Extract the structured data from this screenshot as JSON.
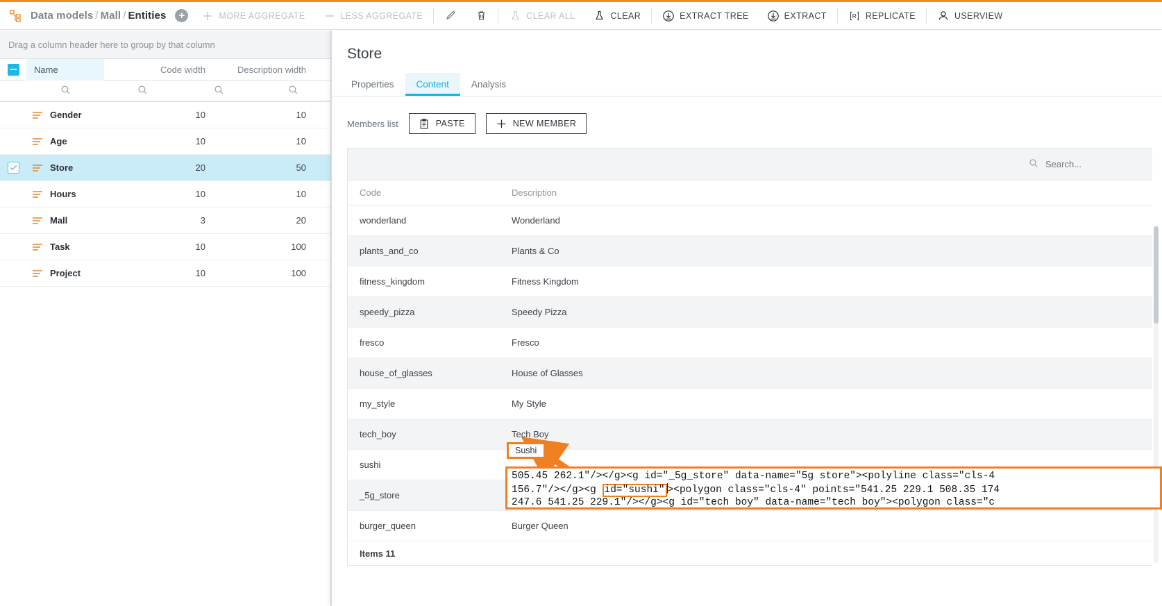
{
  "toolbar": {
    "breadcrumb": {
      "root": "Data models",
      "mid": "Mall",
      "leaf": "Entities",
      "sep": "/"
    },
    "add_label": "+",
    "buttons": [
      {
        "name": "more-aggregate",
        "label": "MORE AGGREGATE",
        "icon": "plus-icon",
        "disabled": true
      },
      {
        "name": "less-aggregate",
        "label": "LESS AGGREGATE",
        "icon": "minus-icon",
        "disabled": true
      },
      {
        "name": "edit",
        "label": "",
        "icon": "pencil-icon",
        "disabled": false
      },
      {
        "name": "delete",
        "label": "",
        "icon": "trash-icon",
        "disabled": false
      },
      {
        "name": "clear-all",
        "label": "CLEAR ALL",
        "icon": "flask-icon",
        "disabled": true
      },
      {
        "name": "clear",
        "label": "CLEAR",
        "icon": "flask-icon",
        "disabled": false
      },
      {
        "name": "extract-tree",
        "label": "EXTRACT TREE",
        "icon": "download-circle-icon",
        "disabled": false
      },
      {
        "name": "extract",
        "label": "EXTRACT",
        "icon": "download-circle-icon",
        "disabled": false
      },
      {
        "name": "replicate",
        "label": "REPLICATE",
        "icon": "bracket-r-icon",
        "disabled": false
      },
      {
        "name": "userview",
        "label": "USERVIEW",
        "icon": "user-icon",
        "disabled": false
      }
    ]
  },
  "left_grid": {
    "group_panel_text": "Drag a column header here to group by that column",
    "columns": [
      "Name",
      "Code width",
      "Description width"
    ],
    "rows": [
      {
        "name": "Gender",
        "code_width": "10",
        "description_width": "10",
        "selected": false
      },
      {
        "name": "Age",
        "code_width": "10",
        "description_width": "10",
        "selected": false
      },
      {
        "name": "Store",
        "code_width": "20",
        "description_width": "50",
        "selected": true
      },
      {
        "name": "Hours",
        "code_width": "10",
        "description_width": "10",
        "selected": false
      },
      {
        "name": "Mall",
        "code_width": "3",
        "description_width": "20",
        "selected": false
      },
      {
        "name": "Task",
        "code_width": "10",
        "description_width": "100",
        "selected": false
      },
      {
        "name": "Project",
        "code_width": "10",
        "description_width": "100",
        "selected": false
      }
    ]
  },
  "detail": {
    "title": "Store",
    "tabs": [
      {
        "label": "Properties",
        "active": false
      },
      {
        "label": "Content",
        "active": true
      },
      {
        "label": "Analysis",
        "active": false
      }
    ],
    "members_label": "Members list",
    "paste_button": "PASTE",
    "new_member_button": "NEW MEMBER",
    "search_placeholder": "Search...",
    "table": {
      "columns": [
        "Code",
        "Description"
      ],
      "rows": [
        {
          "code": "wonderland",
          "description": "Wonderland"
        },
        {
          "code": "plants_and_co",
          "description": "Plants & Co"
        },
        {
          "code": "fitness_kingdom",
          "description": "Fitness Kingdom"
        },
        {
          "code": "speedy_pizza",
          "description": "Speedy Pizza"
        },
        {
          "code": "fresco",
          "description": "Fresco"
        },
        {
          "code": "house_of_glasses",
          "description": "House of Glasses"
        },
        {
          "code": "my_style",
          "description": "My Style"
        },
        {
          "code": "tech_boy",
          "description": "Tech Boy"
        },
        {
          "code": "sushi",
          "description": "Sushi"
        },
        {
          "code": "_5g_store",
          "description": ""
        },
        {
          "code": "burger_queen",
          "description": "Burger Queen"
        }
      ],
      "footer": "Items 11"
    }
  },
  "annotation": {
    "highlight_value": "Sushi",
    "code_lines": [
      "505.45 262.1\"/></g><g id=\"_5g_store\" data-name=\"5g store\"><polyline class=\"cls-4",
      "156.7\"/></g><g id=\"sushi\"><polygon class=\"cls-4\" points=\"541.25 229.1 508.35 174",
      "247.6 541.25 229.1\"/></g><g id=\"tech boy\" data-name=\"tech boy\"><polygon class=\"c"
    ],
    "code_line2_pre": "156.7\"/></g><g ",
    "code_line2_hl": "id=\"sushi\"",
    "code_line2_post": "><polygon class=\"cls-4\" points=\"541.25 229.1 508.35 174",
    "accent_color": "#ef8022"
  }
}
